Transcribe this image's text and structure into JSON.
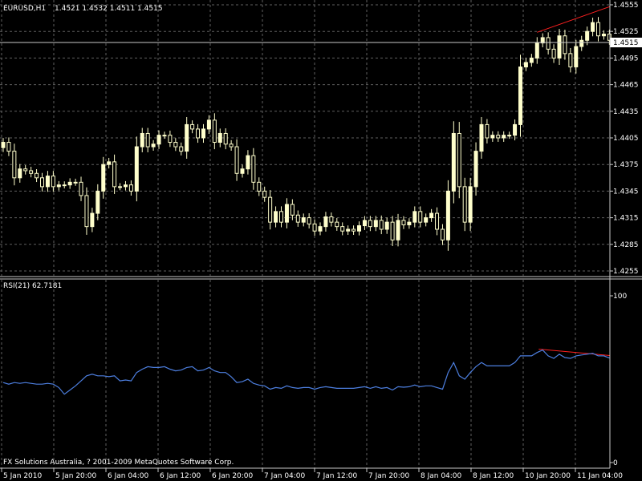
{
  "header": {
    "symbol_label": "EURUSD,H1",
    "ohlc_label": "1.4521 1.4532 1.4511 1.4515"
  },
  "rsi_header": {
    "label": "RSI(21) 62.7181"
  },
  "footer": {
    "copyright": "FX Solutions Australia, ? 2001-2009 MetaQuotes Software Corp."
  },
  "colors": {
    "background": "#000000",
    "candle_bull": "#ffffcc",
    "candle_bear": "#000000",
    "wick": "#ffffcc",
    "grid": "#606060",
    "rsi_line": "#4d7fe0",
    "trendline": "#ff2020",
    "text": "#ffffff"
  },
  "chart_data": [
    {
      "type": "candlestick",
      "title": "EURUSD,H1",
      "ylim": [
        1.4255,
        1.4555
      ],
      "y_ticks": [
        "1.4555",
        "1.4525",
        "1.4495",
        "1.4465",
        "1.4435",
        "1.4405",
        "1.4375",
        "1.4345",
        "1.4315",
        "1.4285",
        "1.4255"
      ],
      "current_price": "1.4515",
      "x_tick_labels": [
        "5 Jan 2010",
        "5 Jan 20:00",
        "6 Jan 04:00",
        "6 Jan 12:00",
        "6 Jan 20:00",
        "7 Jan 04:00",
        "7 Jan 12:00",
        "7 Jan 20:00",
        "8 Jan 04:00",
        "8 Jan 12:00",
        "10 Jan 20:00",
        "11 Jan 04:00"
      ],
      "closes": [
        1.44,
        1.439,
        1.436,
        1.437,
        1.4368,
        1.4365,
        1.436,
        1.435,
        1.4362,
        1.435,
        1.4352,
        1.4352,
        1.4355,
        1.4355,
        1.434,
        1.4305,
        1.432,
        1.4345,
        1.4375,
        1.4378,
        1.435,
        1.435,
        1.4352,
        1.4345,
        1.4395,
        1.441,
        1.4395,
        1.4398,
        1.4408,
        1.4408,
        1.44,
        1.4395,
        1.439,
        1.442,
        1.4415,
        1.4405,
        1.4415,
        1.4425,
        1.44,
        1.441,
        1.4398,
        1.4395,
        1.4365,
        1.437,
        1.4385,
        1.4355,
        1.4345,
        1.4338,
        1.431,
        1.4322,
        1.431,
        1.433,
        1.4318,
        1.431,
        1.4315,
        1.4308,
        1.43,
        1.4305,
        1.4316,
        1.431,
        1.4305,
        1.43,
        1.4302,
        1.43,
        1.4306,
        1.4312,
        1.4305,
        1.4312,
        1.4302,
        1.431,
        1.429,
        1.4312,
        1.4307,
        1.431,
        1.4322,
        1.431,
        1.4315,
        1.432,
        1.4302,
        1.429,
        1.4345,
        1.441,
        1.435,
        1.431,
        1.435,
        1.439,
        1.442,
        1.4405,
        1.4408,
        1.4405,
        1.4408,
        1.4408,
        1.442,
        1.4485,
        1.449,
        1.4495,
        1.4512,
        1.4518,
        1.4505,
        1.4495,
        1.452,
        1.45,
        1.4485,
        1.4508,
        1.4515,
        1.4525,
        1.4535,
        1.452,
        1.4522,
        1.4515
      ]
    },
    {
      "type": "line",
      "title": "RSI(21) 62.7181",
      "ylim": [
        0,
        100
      ],
      "y_ticks": [
        "100",
        "0"
      ],
      "series": [
        {
          "values": [
            48,
            47,
            48,
            47.5,
            48,
            47.5,
            47,
            47,
            47.5,
            47,
            45,
            41,
            43.5,
            46,
            49,
            52,
            53,
            52,
            52,
            51.5,
            52,
            49,
            49.5,
            49,
            54,
            56,
            57.5,
            57,
            57,
            57.5,
            56,
            55,
            55.5,
            57,
            57.5,
            55,
            55.5,
            57,
            55,
            54,
            54,
            51.5,
            48,
            48.5,
            50,
            47.5,
            46.5,
            46,
            44,
            45,
            44.5,
            46,
            45,
            44.5,
            45,
            45,
            44,
            45,
            45.5,
            45,
            44.5,
            44.5,
            44.5,
            44.5,
            45,
            45.5,
            44.5,
            45.5,
            44.5,
            45,
            43.5,
            45.5,
            45.2,
            45.5,
            46.5,
            45.5,
            46,
            46,
            45,
            44,
            54,
            60,
            52,
            50,
            54,
            57.5,
            60,
            58,
            58,
            58,
            58,
            58,
            60,
            64,
            64,
            64,
            66,
            67.5,
            64,
            62.5,
            65,
            63,
            62.5,
            64,
            64.5,
            65,
            65.5,
            64,
            64,
            62.7
          ]
        }
      ]
    }
  ]
}
